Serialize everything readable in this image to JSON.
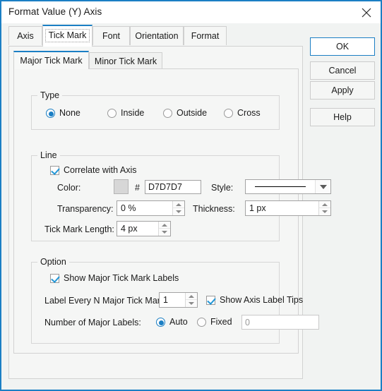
{
  "window": {
    "title": "Format Value (Y) Axis",
    "close_icon": "close-icon",
    "accent_color": "#1b7fc4"
  },
  "tabs": [
    {
      "label": "Axis",
      "active": false
    },
    {
      "label": "Tick Mark",
      "active": true
    },
    {
      "label": "Font",
      "active": false
    },
    {
      "label": "Orientation",
      "active": false
    },
    {
      "label": "Format",
      "active": false
    }
  ],
  "subtabs": [
    {
      "label": "Major Tick Mark",
      "active": true
    },
    {
      "label": "Minor Tick Mark",
      "active": false
    }
  ],
  "type_group": {
    "title": "Type",
    "options": [
      {
        "label": "None",
        "selected": true
      },
      {
        "label": "Inside",
        "selected": false
      },
      {
        "label": "Outside",
        "selected": false
      },
      {
        "label": "Cross",
        "selected": false
      }
    ]
  },
  "line_group": {
    "title": "Line",
    "correlate_label": "Correlate with Axis",
    "correlate_checked": true,
    "color_label": "Color:",
    "color_swatch": "#d7d7d7",
    "hash_symbol": "#",
    "color_value": "D7D7D7",
    "style_label": "Style:",
    "style_value": "solid-line",
    "transparency_label": "Transparency:",
    "transparency_value": "0 %",
    "thickness_label": "Thickness:",
    "thickness_value": "1 px",
    "tick_length_label": "Tick Mark Length:",
    "tick_length_value": "4 px"
  },
  "option_group": {
    "title": "Option",
    "show_major_labels_label": "Show Major Tick Mark Labels",
    "show_major_labels_checked": true,
    "label_every_n_label": "Label Every N Major Tick Marks:",
    "label_every_n_value": "1",
    "show_axis_tips_label": "Show Axis Label Tips",
    "show_axis_tips_checked": true,
    "number_of_major_labels_label": "Number of Major Labels:",
    "auto_label": "Auto",
    "auto_selected": true,
    "fixed_label": "Fixed",
    "fixed_selected": false,
    "fixed_value": "0"
  },
  "buttons": {
    "ok": "OK",
    "cancel": "Cancel",
    "apply": "Apply",
    "help": "Help"
  }
}
